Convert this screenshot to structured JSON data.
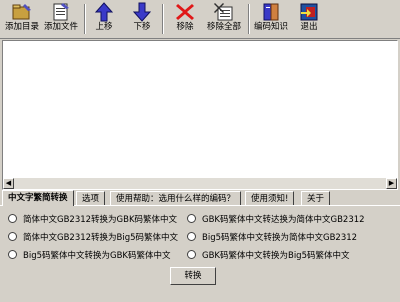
{
  "toolbar": {
    "add_dir": "添加目录",
    "add_file": "添加文件",
    "move_up": "上移",
    "move_down": "下移",
    "remove": "移除",
    "remove_all": "移除全部",
    "encoding_info": "编码知识",
    "exit": "退出"
  },
  "tabs": [
    "中文字繁简转换",
    "选项",
    "使用帮助：选用什么样的编码？",
    "使用须知!",
    "关于"
  ],
  "options": [
    "简体中文GB2312转换为GBK码繁体中文",
    "简体中文GB2312转换为Big5码繁体中文",
    "Big5码繁体中文转换为GBK码繁体中文",
    "GBK码繁体中文转达换为简体中文GB2312",
    "Big5码繁体中文转换为简体中文GB2312",
    "GBK码繁体中文转换为Big5码繁体中文"
  ],
  "convert_label": "转换",
  "colors": {
    "face": "#d4d0c8",
    "up_arrow": "#3a3ac8",
    "remove_x": "#e01818"
  }
}
